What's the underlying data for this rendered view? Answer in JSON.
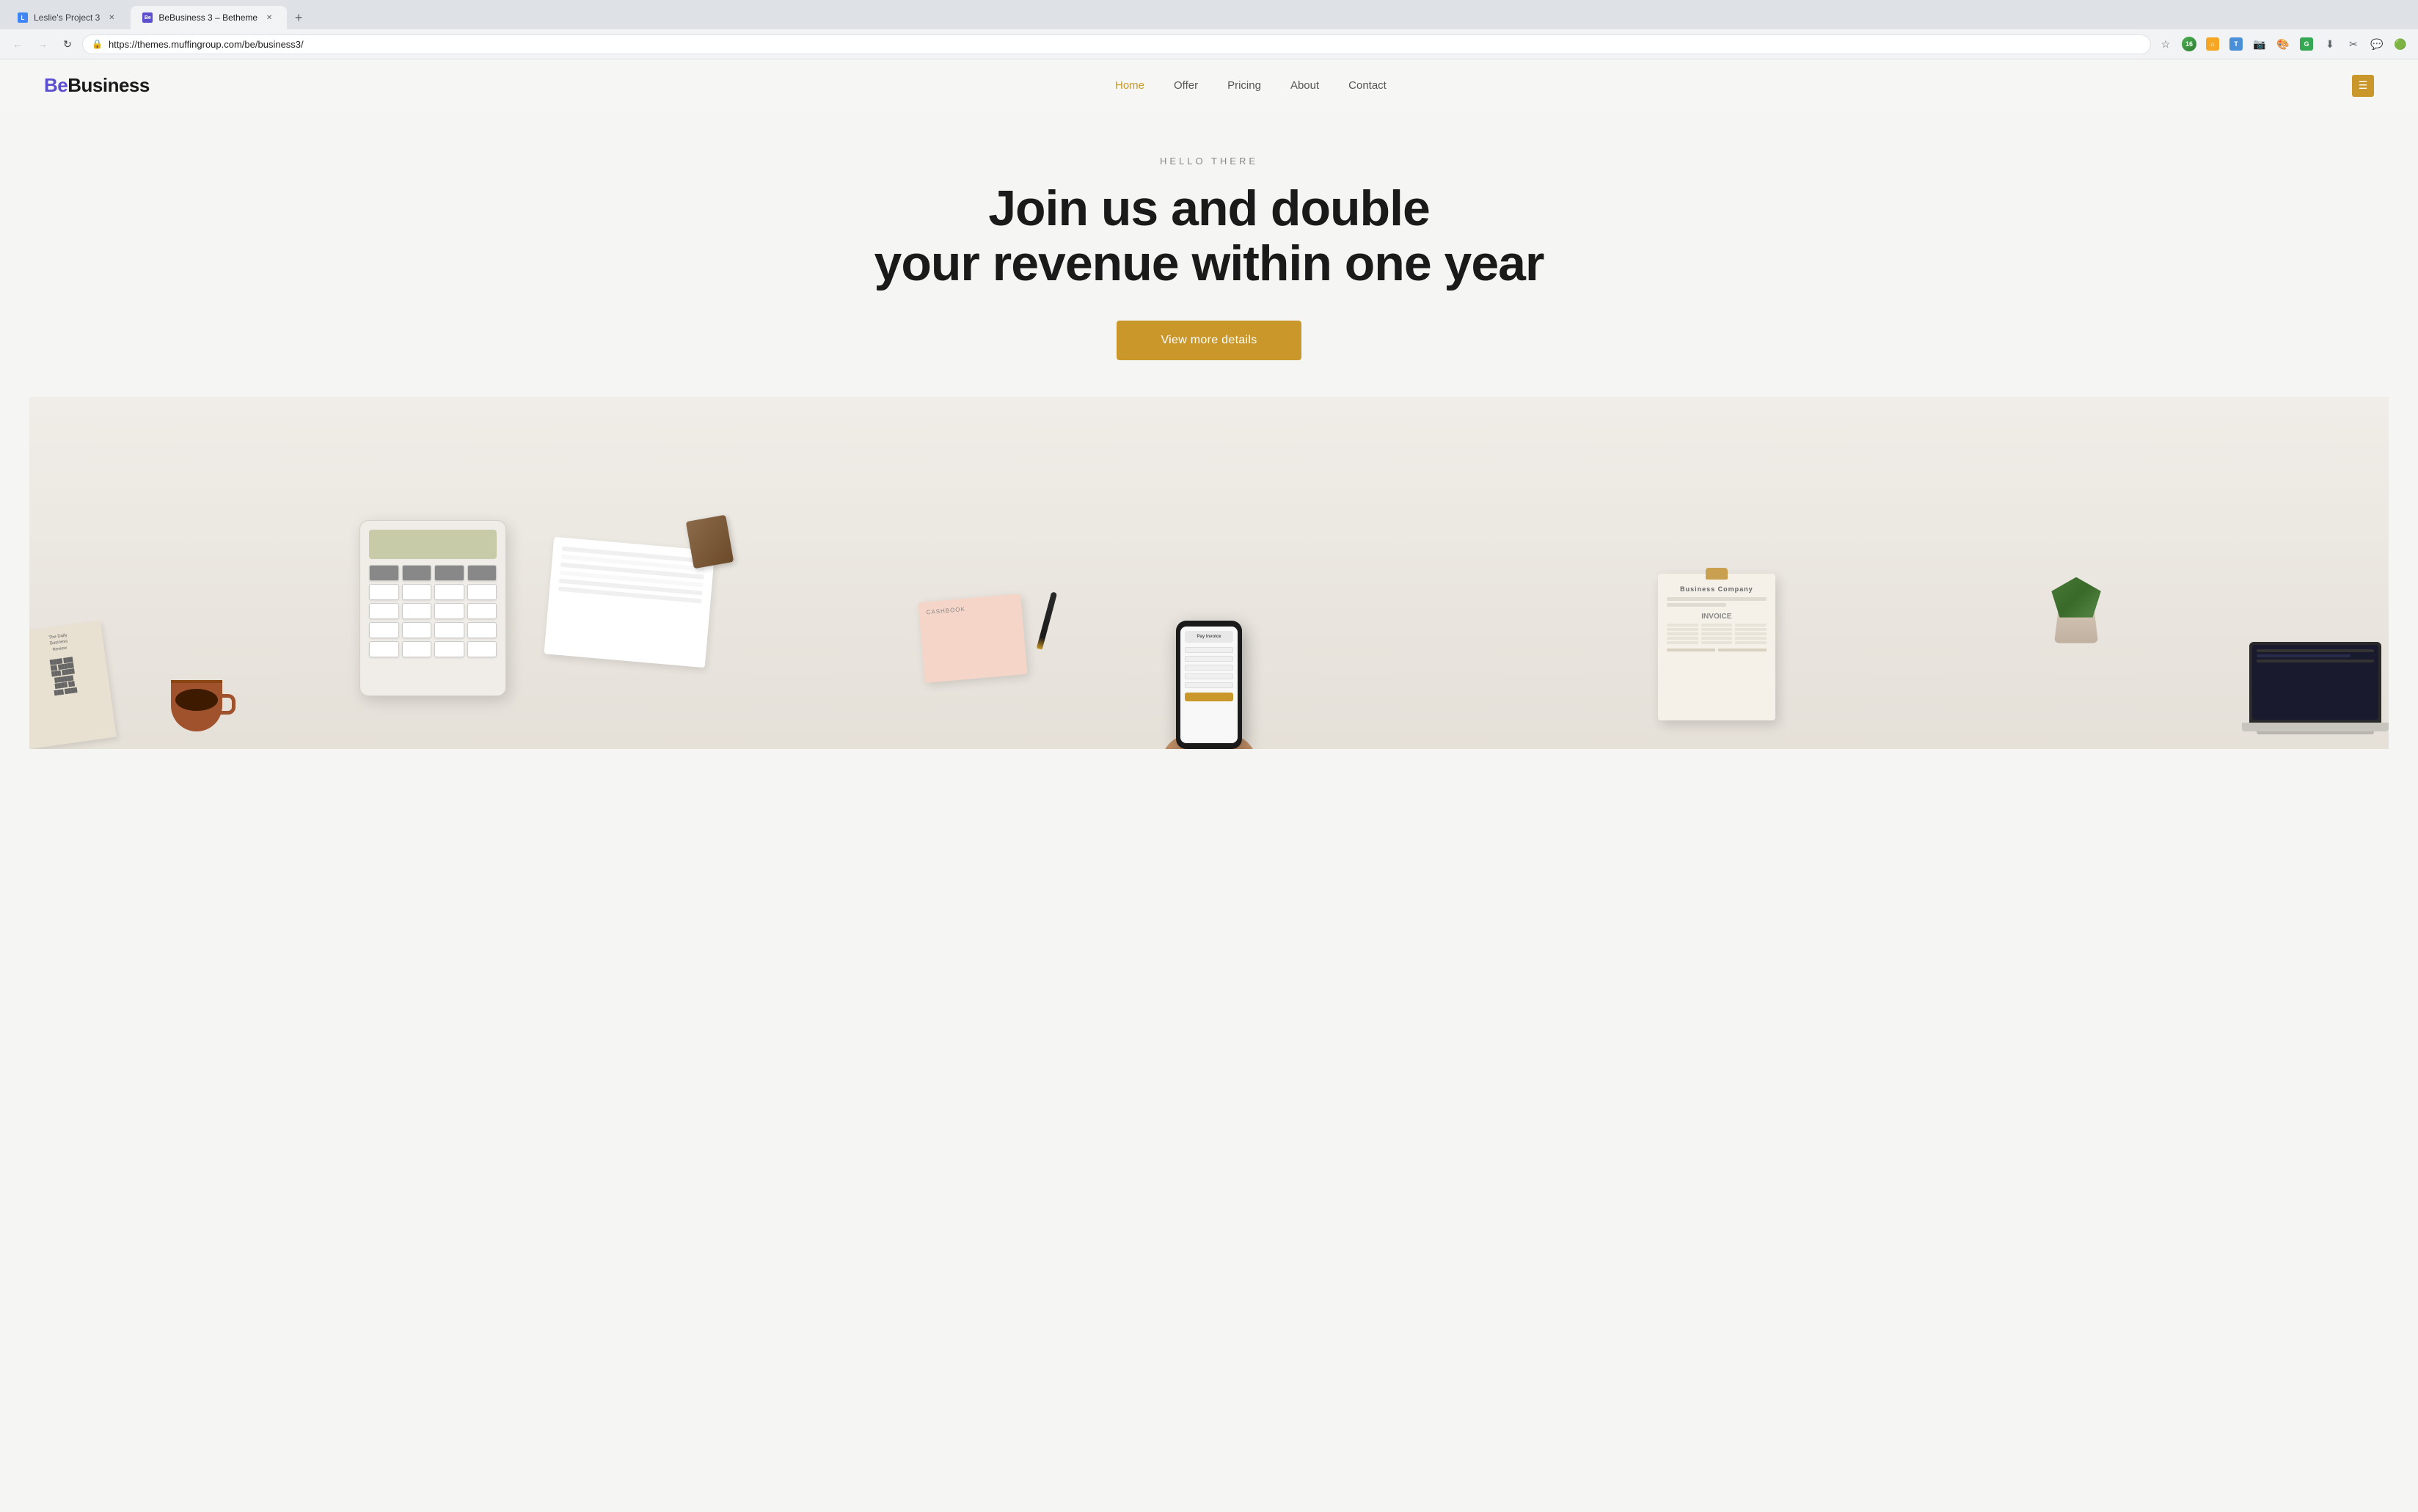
{
  "browser": {
    "tabs": [
      {
        "id": "tab-1",
        "label": "Leslie's Project 3",
        "favicon": "L",
        "favicon_color": "#4285f4",
        "active": false
      },
      {
        "id": "tab-2",
        "label": "BeBusiness 3 – Betheme",
        "favicon": "Be",
        "favicon_color": "#5b4fcf",
        "active": true
      }
    ],
    "url": "https://themes.muffingroup.com/be/business3/",
    "back_title": "Back",
    "forward_title": "Forward",
    "reload_title": "Reload",
    "bookmark_title": "Bookmark",
    "profile_title": "Profile"
  },
  "website": {
    "logo": "BeBusiness",
    "logo_prefix": "Be",
    "logo_suffix": "Business",
    "nav_items": [
      {
        "label": "Home",
        "active": true
      },
      {
        "label": "Offer",
        "active": false
      },
      {
        "label": "Pricing",
        "active": false
      },
      {
        "label": "About",
        "active": false
      },
      {
        "label": "Contact",
        "active": false
      }
    ],
    "hero": {
      "subtitle": "HELLO THERE",
      "title_line1": "Join us and double",
      "title_line2": "your revenue within one year",
      "cta_label": "View more details"
    }
  },
  "colors": {
    "accent": "#c9972a",
    "nav_active": "#c9972a",
    "background": "#f5f5f3",
    "hero_text": "#1a1a1a",
    "subtitle_color": "#888888",
    "cta_bg": "#c9972a",
    "cta_text": "#ffffff"
  }
}
